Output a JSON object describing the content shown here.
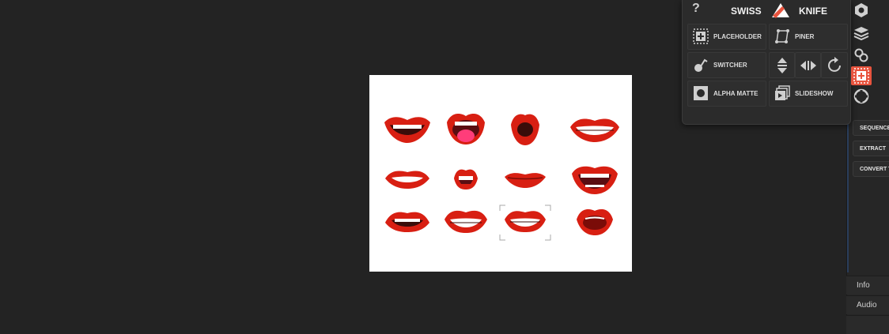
{
  "popup": {
    "help_symbol": "?",
    "title_left": "SWISS",
    "title_right": "KNIFE",
    "buttons": {
      "placeholder": "PLACEHOLDER",
      "piner": "PINER",
      "switcher": "SWITCHER",
      "alpha_matte": "ALPHA MATTE",
      "slideshow": "SLIDESHOW"
    },
    "accent_color": "#e8543e"
  },
  "side_panel": {
    "buttons": [
      "SEQUENCE",
      "EXTRACT",
      "CONVERT TO"
    ],
    "tabs": [
      "Info",
      "Audio"
    ]
  },
  "canvas": {
    "content": "12 red lip illustrations arranged in a 4x3 grid",
    "background": "#ffffff"
  }
}
